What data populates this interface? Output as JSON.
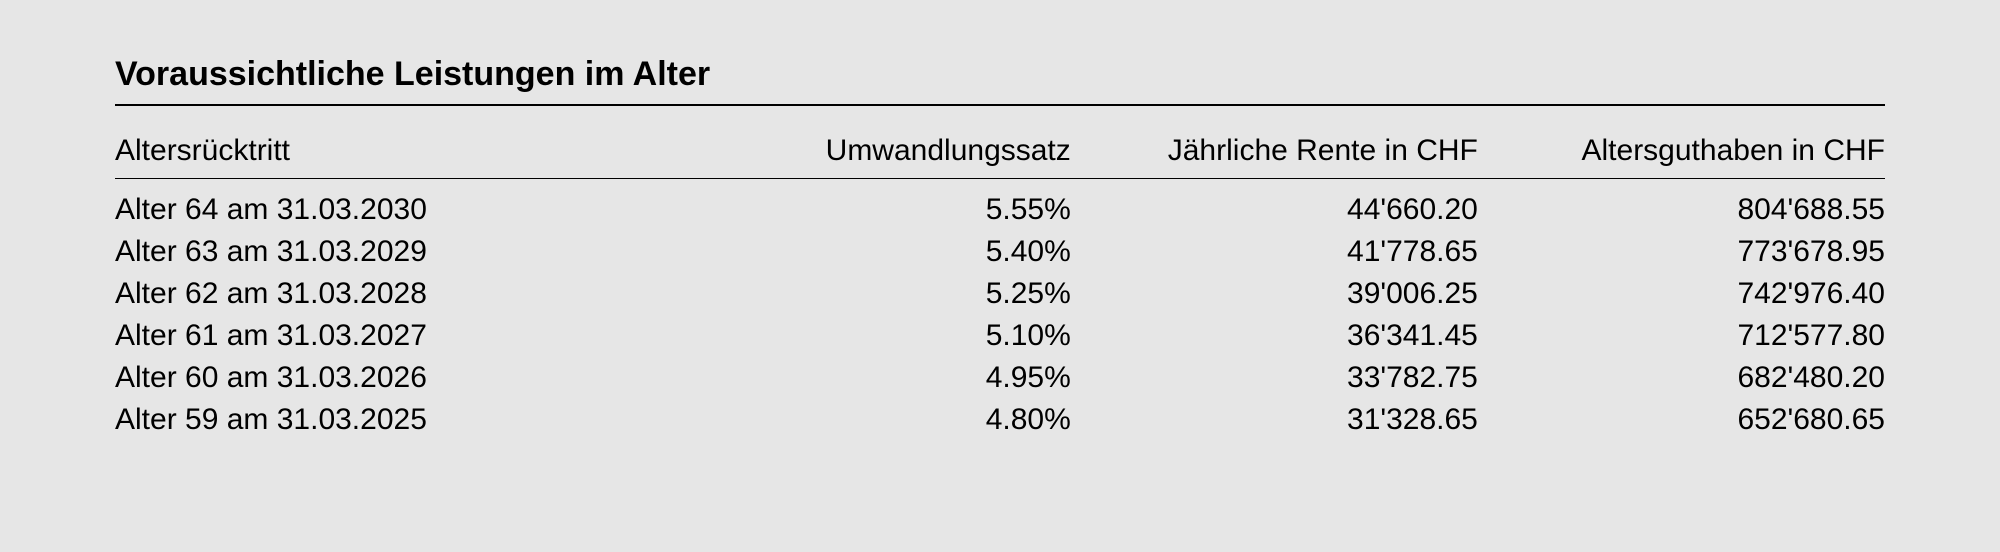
{
  "title": "Voraussichtliche Leistungen im Alter",
  "headers": {
    "col1": "Altersrücktritt",
    "col2": "Umwandlungssatz",
    "col3": "Jährliche Rente in CHF",
    "col4": "Altersguthaben in CHF"
  },
  "rows": [
    {
      "col1": "Alter 64 am 31.03.2030",
      "col2": "5.55%",
      "col3": "44'660.20",
      "col4": "804'688.55"
    },
    {
      "col1": "Alter 63 am 31.03.2029",
      "col2": "5.40%",
      "col3": "41'778.65",
      "col4": "773'678.95"
    },
    {
      "col1": "Alter 62 am 31.03.2028",
      "col2": "5.25%",
      "col3": "39'006.25",
      "col4": "742'976.40"
    },
    {
      "col1": "Alter 61 am 31.03.2027",
      "col2": "5.10%",
      "col3": "36'341.45",
      "col4": "712'577.80"
    },
    {
      "col1": "Alter 60 am 31.03.2026",
      "col2": "4.95%",
      "col3": "33'782.75",
      "col4": "682'480.20"
    },
    {
      "col1": "Alter 59 am 31.03.2025",
      "col2": "4.80%",
      "col3": "31'328.65",
      "col4": "652'680.65"
    }
  ]
}
